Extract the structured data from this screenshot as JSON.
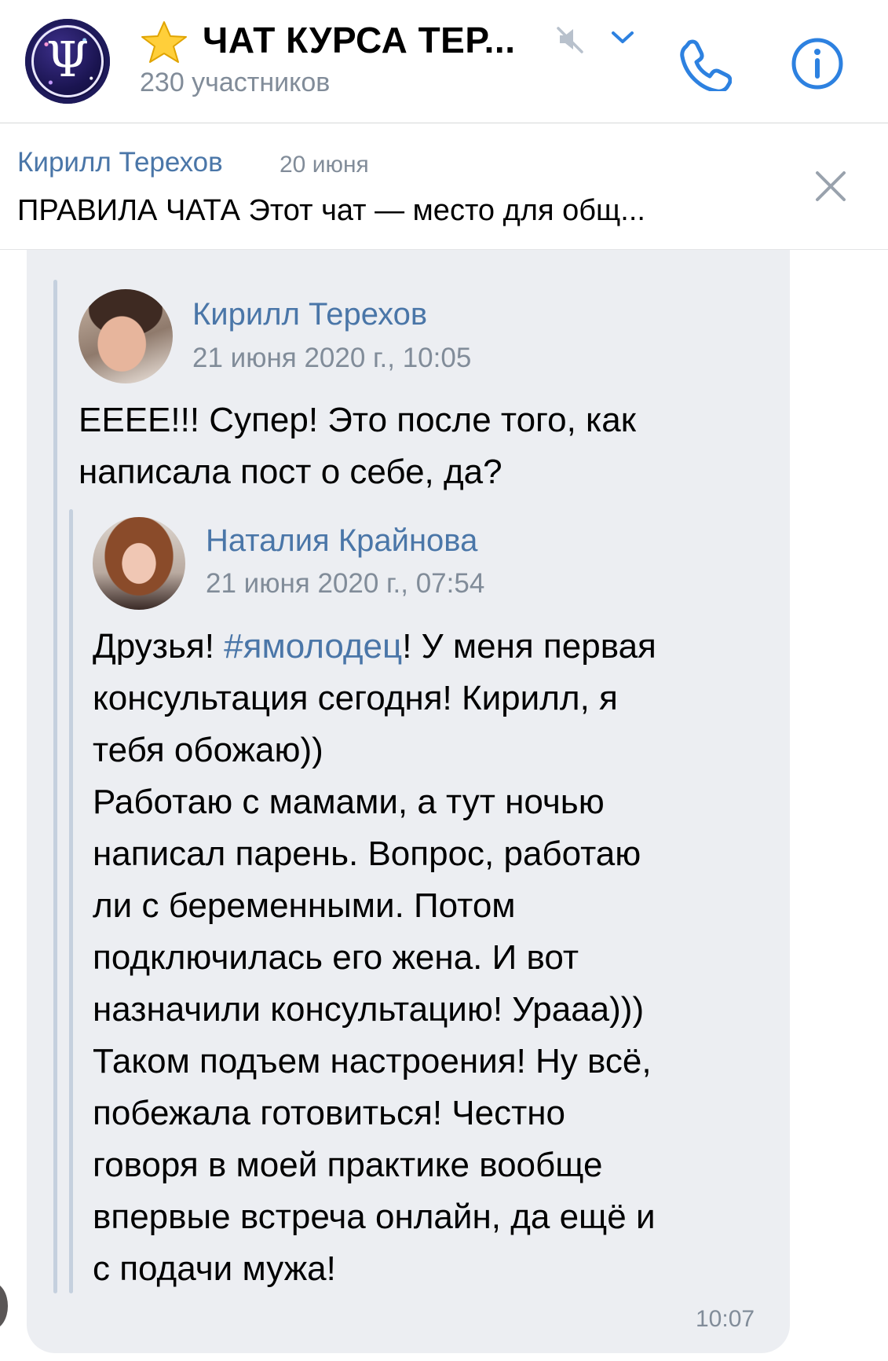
{
  "header": {
    "title": "ЧАТ КУРСА ТЕР...",
    "subtitle": "230 участников",
    "avatar_glyph": "Ψ",
    "icons": [
      "star-icon",
      "mute-icon",
      "chevron-down-icon",
      "phone-icon",
      "info-icon"
    ]
  },
  "pinned": {
    "author": "Кирилл Терехов",
    "date": "20 июня",
    "text": "ПРАВИЛА ЧАТА Этот чат — место для общ..."
  },
  "message": {
    "author": "Кирилл Терехов",
    "datetime": "21 июня 2020 г., 10:05",
    "text": "ЕЕЕЕ!!! Супер! Это после того, как\nнаписала пост о себе, да?",
    "time": "10:07",
    "forwarded": {
      "author": "Наталия Крайнова",
      "datetime": "21 июня 2020 г., 07:54",
      "text_before_hashtag": "Друзья! ",
      "hashtag": "#ямолодец",
      "text_after_hashtag": "! У меня первая\nконсультация сегодня! Кирилл, я\nтебя обожаю))\nРаботаю с мамами, а тут ночью\nнаписал парень. Вопрос, работаю\nли с беременными. Потом\nподключилась его жена. И вот\nназначили консультацию! Урааа)))\nТаком подъем настроения! Ну всё,\nпобежала готовиться! Честно\nговоря в моей практике вообще\nвпервые встреча онлайн, да ещё и\nс подачи мужа!"
    }
  },
  "colors": {
    "link": "#4a76a8",
    "secondary": "#818c99",
    "bubble": "#eceef2",
    "accent": "#2d81e0"
  }
}
